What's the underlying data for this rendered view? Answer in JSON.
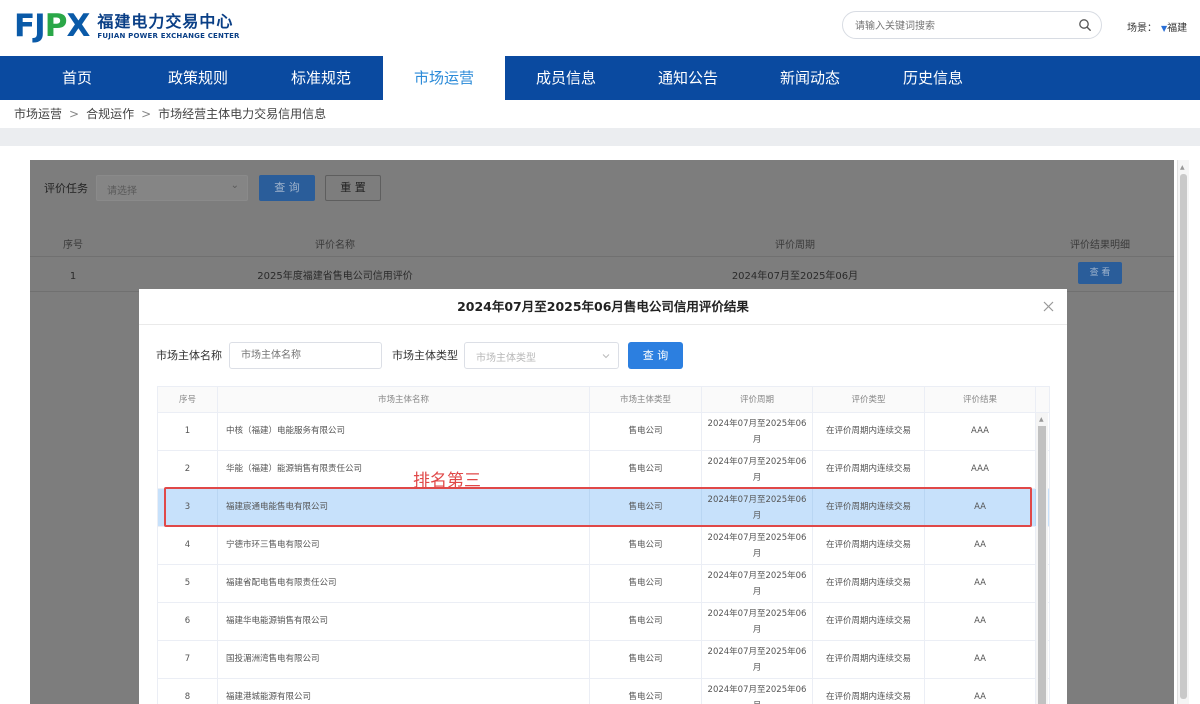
{
  "logo": {
    "mark": "FJPX",
    "cn": "福建电力交易中心",
    "en": "FUJIAN POWER EXCHANGE CENTER"
  },
  "header": {
    "search_placeholder": "请输入关键词搜索",
    "scene_label": "场景：",
    "scene_value": "福建"
  },
  "nav": [
    {
      "label": "首页"
    },
    {
      "label": "政策规则"
    },
    {
      "label": "标准规范"
    },
    {
      "label": "市场运营",
      "active": true
    },
    {
      "label": "成员信息"
    },
    {
      "label": "通知公告"
    },
    {
      "label": "新闻动态"
    },
    {
      "label": "历史信息"
    }
  ],
  "breadcrumb": [
    "市场运营",
    "合规运作",
    "市场经营主体电力交易信用信息"
  ],
  "background": {
    "filter_label": "评价任务",
    "select_placeholder": "请选择",
    "query_label": "查 询",
    "reset_label": "重 置",
    "columns": [
      "序号",
      "评价名称",
      "评价周期",
      "评价结果明细"
    ],
    "rows": [
      {
        "index": "1",
        "name": "2025年度福建省售电公司信用评价",
        "period": "2024年07月至2025年06月",
        "action": "查 看"
      }
    ]
  },
  "modal": {
    "title": "2024年07月至2025年06月售电公司信用评价结果",
    "filter1_label": "市场主体名称",
    "filter1_placeholder": "市场主体名称",
    "filter2_label": "市场主体类型",
    "filter2_placeholder": "市场主体类型",
    "query_label": "查 询",
    "columns": [
      "序号",
      "市场主体名称",
      "市场主体类型",
      "评价周期",
      "评价类型",
      "评价结果"
    ],
    "rows": [
      {
        "index": "1",
        "name": "中核（福建）电能服务有限公司",
        "type": "售电公司",
        "period_l1": "2024年07月至2025年06",
        "period_l2": "月",
        "eval_type": "在评价周期内连续交易",
        "result": "AAA"
      },
      {
        "index": "2",
        "name": "华能（福建）能源销售有限责任公司",
        "type": "售电公司",
        "period_l1": "2024年07月至2025年06",
        "period_l2": "月",
        "eval_type": "在评价周期内连续交易",
        "result": "AAA"
      },
      {
        "index": "3",
        "name": "福建宸通电能售电有限公司",
        "type": "售电公司",
        "period_l1": "2024年07月至2025年06",
        "period_l2": "月",
        "eval_type": "在评价周期内连续交易",
        "result": "AA"
      },
      {
        "index": "4",
        "name": "宁德市环三售电有限公司",
        "type": "售电公司",
        "period_l1": "2024年07月至2025年06",
        "period_l2": "月",
        "eval_type": "在评价周期内连续交易",
        "result": "AA"
      },
      {
        "index": "5",
        "name": "福建省配电售电有限责任公司",
        "type": "售电公司",
        "period_l1": "2024年07月至2025年06",
        "period_l2": "月",
        "eval_type": "在评价周期内连续交易",
        "result": "AA"
      },
      {
        "index": "6",
        "name": "福建华电能源销售有限公司",
        "type": "售电公司",
        "period_l1": "2024年07月至2025年06",
        "period_l2": "月",
        "eval_type": "在评价周期内连续交易",
        "result": "AA"
      },
      {
        "index": "7",
        "name": "国投湄洲湾售电有限公司",
        "type": "售电公司",
        "period_l1": "2024年07月至2025年06",
        "period_l2": "月",
        "eval_type": "在评价周期内连续交易",
        "result": "AA"
      },
      {
        "index": "8",
        "name": "福建港城能源有限公司",
        "type": "售电公司",
        "period_l1": "2024年07月至2025年06",
        "period_l2": "月",
        "eval_type": "在评价周期内连续交易",
        "result": "AA"
      }
    ]
  },
  "annotation": {
    "text": "排名第三",
    "color": "#e04848"
  }
}
